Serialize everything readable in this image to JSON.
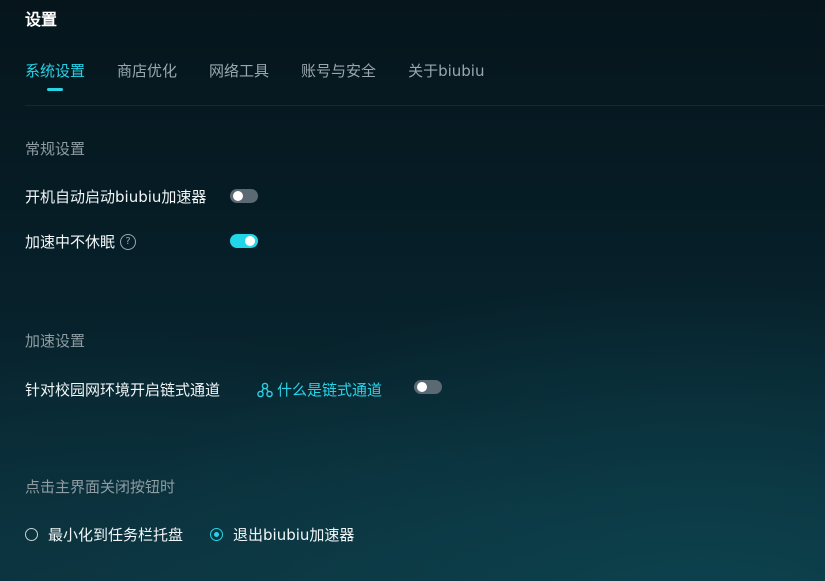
{
  "window": {
    "title": "设置"
  },
  "tabs": [
    {
      "label": "系统设置",
      "active": true
    },
    {
      "label": "商店优化",
      "active": false
    },
    {
      "label": "网络工具",
      "active": false
    },
    {
      "label": "账号与安全",
      "active": false
    },
    {
      "label": "关于biubiu",
      "active": false
    }
  ],
  "general": {
    "title": "常规设置",
    "autostart": {
      "label": "开机自动启动biubiu加速器",
      "enabled": false
    },
    "nosleep": {
      "label": "加速中不休眠",
      "help_icon": "question-circle-icon",
      "enabled": true
    }
  },
  "acceleration": {
    "title": "加速设置",
    "chain": {
      "label": "针对校园网环境开启链式通道",
      "link_label": "什么是链式通道",
      "link_icon": "nodes-icon",
      "enabled": false
    }
  },
  "close_behavior": {
    "title": "点击主界面关闭按钮时",
    "options": [
      {
        "label": "最小化到任务栏托盘",
        "selected": false
      },
      {
        "label": "退出biubiu加速器",
        "selected": true
      }
    ]
  },
  "colors": {
    "accent": "#27d3e6",
    "toggle_off": "#5b6a72",
    "text_muted": "#8f9ca2"
  }
}
